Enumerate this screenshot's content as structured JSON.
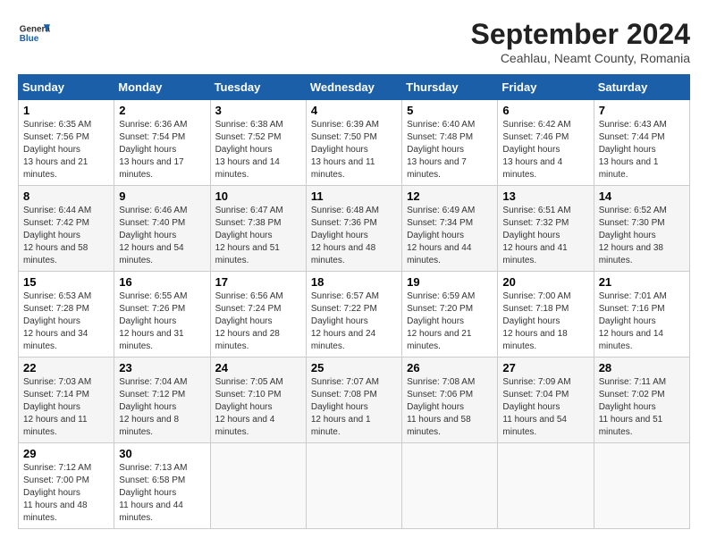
{
  "header": {
    "logo_line1": "General",
    "logo_line2": "Blue",
    "month": "September 2024",
    "location": "Ceahlau, Neamt County, Romania"
  },
  "weekdays": [
    "Sunday",
    "Monday",
    "Tuesday",
    "Wednesday",
    "Thursday",
    "Friday",
    "Saturday"
  ],
  "weeks": [
    [
      {
        "day": "1",
        "sunrise": "6:35 AM",
        "sunset": "7:56 PM",
        "daylight": "13 hours and 21 minutes."
      },
      {
        "day": "2",
        "sunrise": "6:36 AM",
        "sunset": "7:54 PM",
        "daylight": "13 hours and 17 minutes."
      },
      {
        "day": "3",
        "sunrise": "6:38 AM",
        "sunset": "7:52 PM",
        "daylight": "13 hours and 14 minutes."
      },
      {
        "day": "4",
        "sunrise": "6:39 AM",
        "sunset": "7:50 PM",
        "daylight": "13 hours and 11 minutes."
      },
      {
        "day": "5",
        "sunrise": "6:40 AM",
        "sunset": "7:48 PM",
        "daylight": "13 hours and 7 minutes."
      },
      {
        "day": "6",
        "sunrise": "6:42 AM",
        "sunset": "7:46 PM",
        "daylight": "13 hours and 4 minutes."
      },
      {
        "day": "7",
        "sunrise": "6:43 AM",
        "sunset": "7:44 PM",
        "daylight": "13 hours and 1 minute."
      }
    ],
    [
      {
        "day": "8",
        "sunrise": "6:44 AM",
        "sunset": "7:42 PM",
        "daylight": "12 hours and 58 minutes."
      },
      {
        "day": "9",
        "sunrise": "6:46 AM",
        "sunset": "7:40 PM",
        "daylight": "12 hours and 54 minutes."
      },
      {
        "day": "10",
        "sunrise": "6:47 AM",
        "sunset": "7:38 PM",
        "daylight": "12 hours and 51 minutes."
      },
      {
        "day": "11",
        "sunrise": "6:48 AM",
        "sunset": "7:36 PM",
        "daylight": "12 hours and 48 minutes."
      },
      {
        "day": "12",
        "sunrise": "6:49 AM",
        "sunset": "7:34 PM",
        "daylight": "12 hours and 44 minutes."
      },
      {
        "day": "13",
        "sunrise": "6:51 AM",
        "sunset": "7:32 PM",
        "daylight": "12 hours and 41 minutes."
      },
      {
        "day": "14",
        "sunrise": "6:52 AM",
        "sunset": "7:30 PM",
        "daylight": "12 hours and 38 minutes."
      }
    ],
    [
      {
        "day": "15",
        "sunrise": "6:53 AM",
        "sunset": "7:28 PM",
        "daylight": "12 hours and 34 minutes."
      },
      {
        "day": "16",
        "sunrise": "6:55 AM",
        "sunset": "7:26 PM",
        "daylight": "12 hours and 31 minutes."
      },
      {
        "day": "17",
        "sunrise": "6:56 AM",
        "sunset": "7:24 PM",
        "daylight": "12 hours and 28 minutes."
      },
      {
        "day": "18",
        "sunrise": "6:57 AM",
        "sunset": "7:22 PM",
        "daylight": "12 hours and 24 minutes."
      },
      {
        "day": "19",
        "sunrise": "6:59 AM",
        "sunset": "7:20 PM",
        "daylight": "12 hours and 21 minutes."
      },
      {
        "day": "20",
        "sunrise": "7:00 AM",
        "sunset": "7:18 PM",
        "daylight": "12 hours and 18 minutes."
      },
      {
        "day": "21",
        "sunrise": "7:01 AM",
        "sunset": "7:16 PM",
        "daylight": "12 hours and 14 minutes."
      }
    ],
    [
      {
        "day": "22",
        "sunrise": "7:03 AM",
        "sunset": "7:14 PM",
        "daylight": "12 hours and 11 minutes."
      },
      {
        "day": "23",
        "sunrise": "7:04 AM",
        "sunset": "7:12 PM",
        "daylight": "12 hours and 8 minutes."
      },
      {
        "day": "24",
        "sunrise": "7:05 AM",
        "sunset": "7:10 PM",
        "daylight": "12 hours and 4 minutes."
      },
      {
        "day": "25",
        "sunrise": "7:07 AM",
        "sunset": "7:08 PM",
        "daylight": "12 hours and 1 minute."
      },
      {
        "day": "26",
        "sunrise": "7:08 AM",
        "sunset": "7:06 PM",
        "daylight": "11 hours and 58 minutes."
      },
      {
        "day": "27",
        "sunrise": "7:09 AM",
        "sunset": "7:04 PM",
        "daylight": "11 hours and 54 minutes."
      },
      {
        "day": "28",
        "sunrise": "7:11 AM",
        "sunset": "7:02 PM",
        "daylight": "11 hours and 51 minutes."
      }
    ],
    [
      {
        "day": "29",
        "sunrise": "7:12 AM",
        "sunset": "7:00 PM",
        "daylight": "11 hours and 48 minutes."
      },
      {
        "day": "30",
        "sunrise": "7:13 AM",
        "sunset": "6:58 PM",
        "daylight": "11 hours and 44 minutes."
      },
      null,
      null,
      null,
      null,
      null
    ]
  ]
}
